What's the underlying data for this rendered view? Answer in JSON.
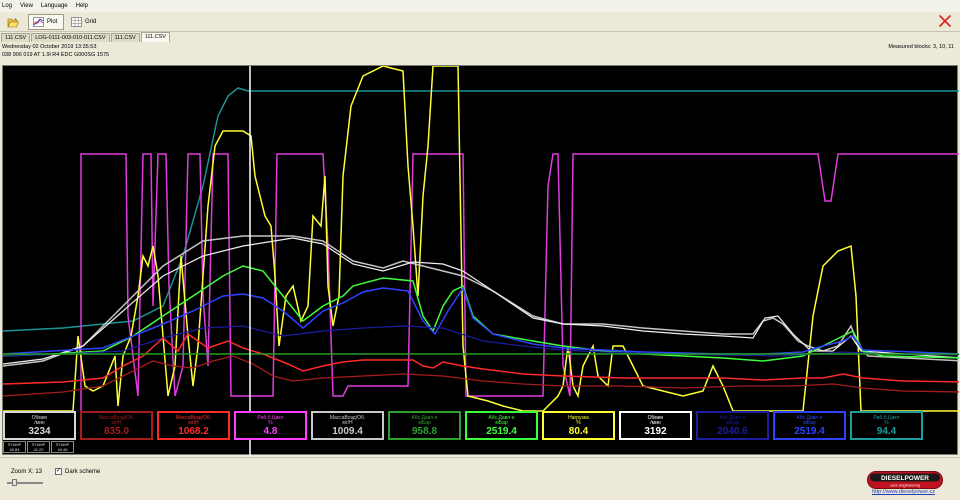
{
  "menu": [
    "Log",
    "View",
    "Language",
    "Help"
  ],
  "toolbar": {
    "plot_label": "Plot",
    "grid_label": "Grid"
  },
  "tabs": [
    {
      "label": "111.CSV"
    },
    {
      "label": "LOG-0111-003-010-011.CSV"
    },
    {
      "label": "111.CSV"
    },
    {
      "label": "111.CSV",
      "active": true
    }
  ],
  "info": {
    "date": "Wednesday 02 October 2019 13:35:53",
    "ecu": "038 906 019 AT  1.9l R4 EDC G000SG  1575",
    "measured_blocks": "Measured blocks: 3, 10, 11"
  },
  "readouts": [
    {
      "label": "Обмин",
      "unit": "/мин",
      "value": "3234",
      "color": "#d8d8d8"
    },
    {
      "label": "МассаВозд/Об.",
      "unit": "мг/Н",
      "value": "835.0",
      "color": "#a51c1c"
    },
    {
      "label": "МассаВозд/Об.",
      "unit": "мг/Н",
      "value": "1068.2",
      "color": "#ff2b2b"
    },
    {
      "label": "Раб.б.Цикл",
      "unit": "%",
      "value": "4.8",
      "color": "#ff3cff"
    },
    {
      "label": "МассаВозд/Об.",
      "unit": "мг/Н",
      "value": "1009.4",
      "color": "#c8c8c8"
    },
    {
      "label": "Абс.Давл-е",
      "unit": "мБар",
      "value": "958.8",
      "color": "#2ea02e"
    },
    {
      "label": "Абс.Давл-е",
      "unit": "мБар",
      "value": "2519.4",
      "color": "#3cff3c"
    },
    {
      "label": "Нагрузка",
      "unit": "%",
      "value": "80.4",
      "color": "#ffff33"
    },
    {
      "label": "Обмин",
      "unit": "/мин",
      "value": "3192",
      "color": "#ffffff"
    },
    {
      "label": "Абс.Давл-е",
      "unit": "мБар",
      "value": "2040.6",
      "color": "#1c1c9e"
    },
    {
      "label": "Абс.Давл-е",
      "unit": "мБар",
      "value": "2519.4",
      "color": "#2f43ff"
    },
    {
      "label": "Раб.б.Цикл",
      "unit": "%",
      "value": "94.4",
      "color": "#1e9b9b"
    }
  ],
  "minis": [
    {
      "label": "STAMP",
      "value": "40.84"
    },
    {
      "label": "STAMP",
      "value": "41.22"
    },
    {
      "label": "STAMP",
      "value": "40.48"
    }
  ],
  "status": {
    "zoom_label": "Zoom X: 13",
    "dark_scheme_label": "Dark scheme",
    "dark_scheme_checked": true,
    "dark_scheme_mark": "✓"
  },
  "logo": {
    "brand": "DIESELPOWER",
    "tagline": "race engineering",
    "url": "http://www.dieselpower.cz"
  },
  "colors": {
    "plot_bg": "#000000",
    "cursor": "#ffffff",
    "ui_bg": "#ece9d8"
  }
}
